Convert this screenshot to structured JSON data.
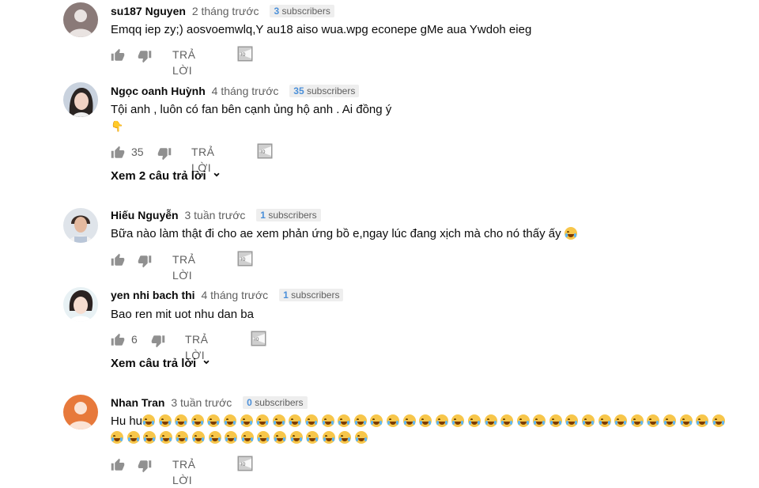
{
  "comments": [
    {
      "author": "su187 Nguyen",
      "time": "2 tháng trước",
      "subscriber_count": "3",
      "subscriber_label": "subscribers",
      "text": "Emqq iep zy;) aosvoemwlq,Y au18 aiso wua.wpg econepe gMe aua Ywdoh eieg",
      "likes": "",
      "reply_label": "TRẢ LỜI"
    },
    {
      "author": "Ngọc oanh Huỳnh",
      "time": "4 tháng trước",
      "subscriber_count": "35",
      "subscriber_label": "subscribers",
      "text": "Tội anh , luôn có fan bên cạnh ủng hộ anh . Ai đồng ý",
      "text_line2": "👇",
      "likes": "35",
      "reply_label": "TRẢ LỜI",
      "view_replies": "Xem 2 câu trả lời"
    },
    {
      "author": "Hiếu Nguyễn",
      "time": "3 tuần trước",
      "subscriber_count": "1",
      "subscriber_label": "subscribers",
      "text": "Bữa nào làm thật đi cho ae xem phản ứng bồ e,ngay lúc đang xịch mà cho nó thấy ấy",
      "likes": "",
      "reply_label": "TRẢ LỜI"
    },
    {
      "author": "yen nhi bach thi",
      "time": "4 tháng trước",
      "subscriber_count": "1",
      "subscriber_label": "subscribers",
      "text": "Bao ren mit uot nhu dan ba",
      "likes": "6",
      "reply_label": "TRẢ LỜI",
      "view_replies": "Xem câu trả lời"
    },
    {
      "author": "Nhan Tran",
      "time": "3 tuần trước",
      "subscriber_count": "0",
      "subscriber_label": "subscribers",
      "text": "Hu hu",
      "likes": "",
      "reply_label": "TRẢ LỜI"
    }
  ],
  "icons": {
    "like": "thumb-up-icon",
    "dislike": "thumb-down-icon",
    "reply_tag": "reply-tag-icon",
    "expand": "chevron-down-icon",
    "emoji_laugh": "tears-of-joy-emoji",
    "emoji_cry": "loudly-crying-emoji"
  },
  "colors": {
    "author": "#0b0b0b",
    "meta": "#606060",
    "subscriber_badge_bg": "#eeeeee",
    "subscriber_count": "#4a8fd9",
    "icon": "#909090"
  }
}
